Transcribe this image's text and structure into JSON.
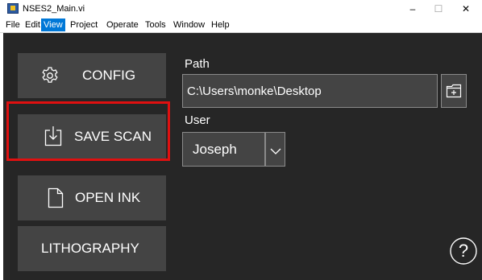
{
  "window": {
    "title": "NSES2_Main.vi",
    "minimize_glyph": "–",
    "maximize_glyph": "☐",
    "close_glyph": "✕"
  },
  "menu": {
    "items": [
      {
        "label": "File"
      },
      {
        "label": "Edit"
      },
      {
        "label": "View"
      },
      {
        "label": "Project"
      },
      {
        "label": "Operate"
      },
      {
        "label": "Tools"
      },
      {
        "label": "Window"
      },
      {
        "label": "Help"
      }
    ],
    "active": "View"
  },
  "buttons": {
    "config": {
      "label": "CONFIG",
      "icon": "gear-icon"
    },
    "save_scan": {
      "label": "SAVE SCAN",
      "icon": "download-icon"
    },
    "open_ink": {
      "label": "OPEN INK",
      "icon": "file-icon"
    },
    "lithography": {
      "label": "LITHOGRAPHY"
    }
  },
  "path": {
    "label": "Path",
    "value": "C:\\Users\\monke\\Desktop"
  },
  "user": {
    "label": "User",
    "value": "Joseph"
  },
  "help": {
    "glyph": "?"
  },
  "colors": {
    "panel_bg": "#262626",
    "button_bg": "#444444",
    "highlight": "#e01010",
    "menu_active": "#0078d7"
  }
}
